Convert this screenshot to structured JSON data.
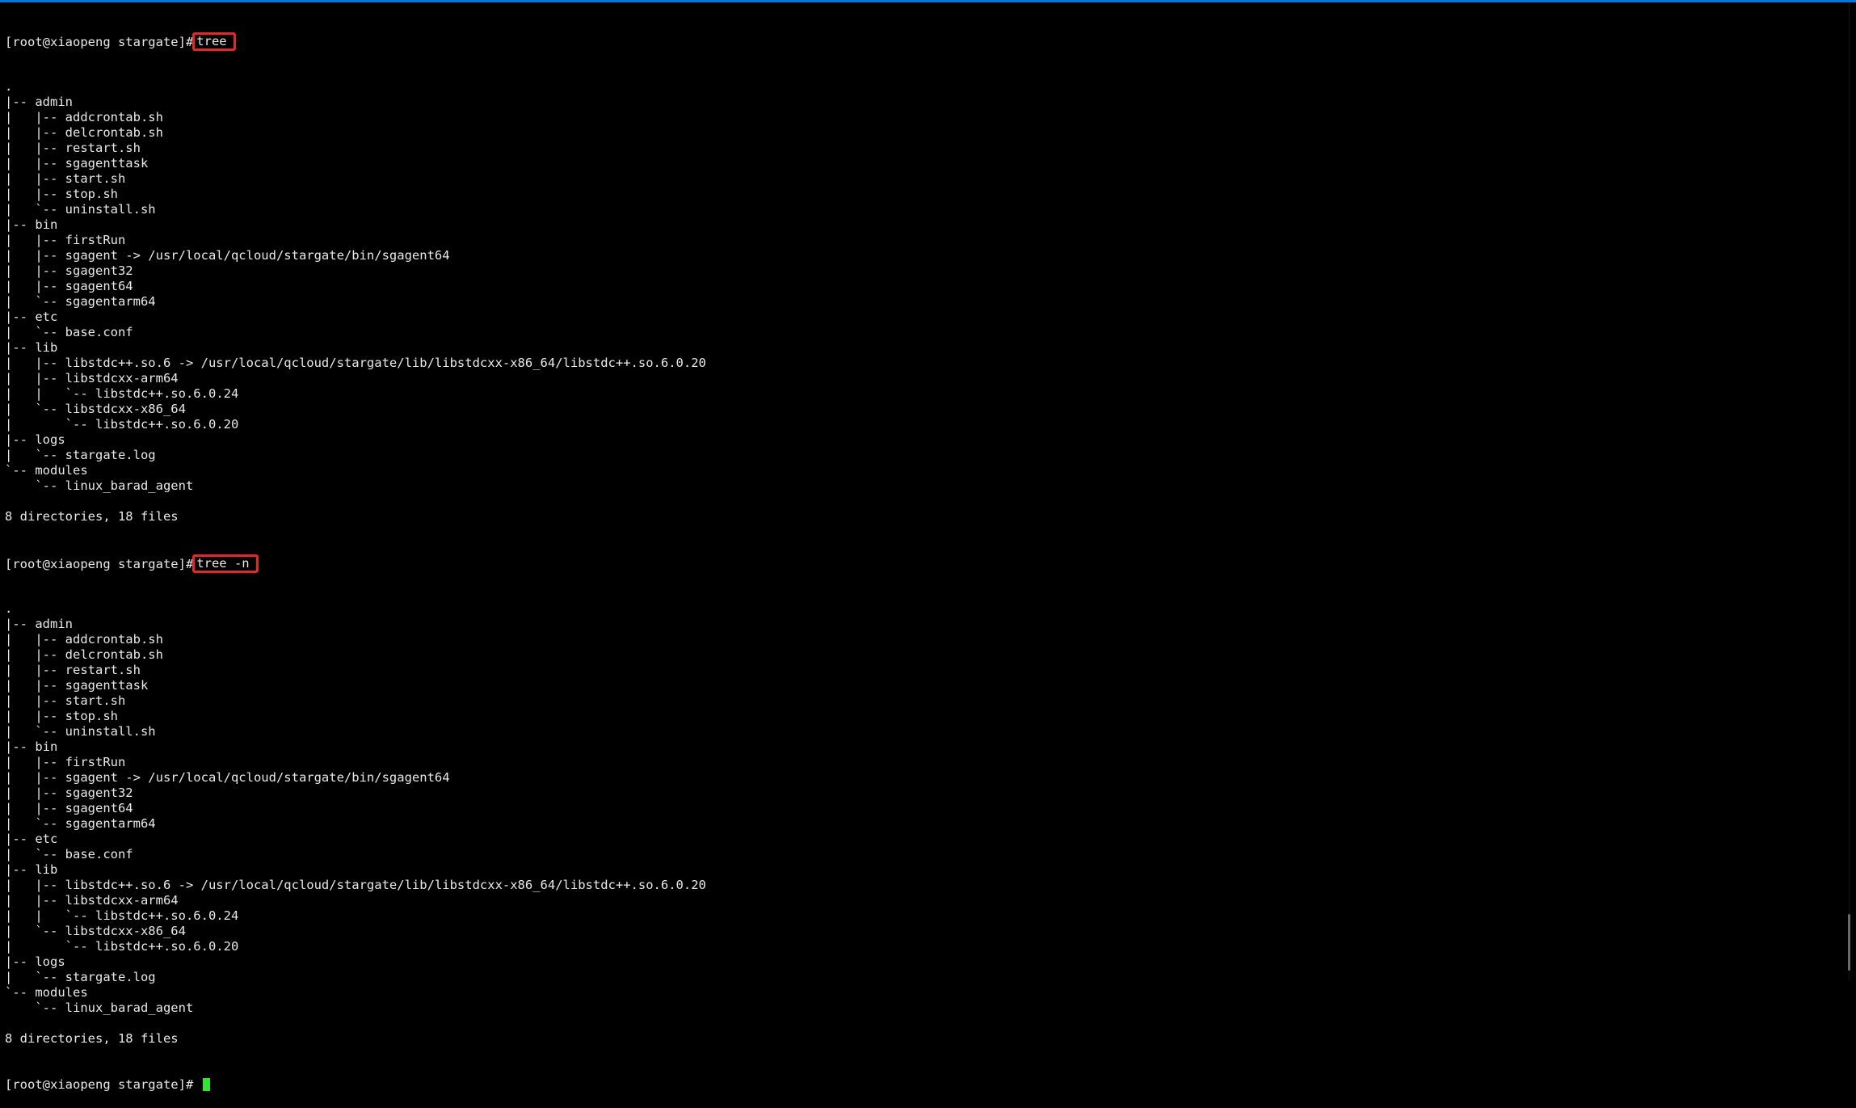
{
  "terminal": {
    "prompt": "[root@xiaopeng stargate]#",
    "command1": "tree",
    "output1": [
      ".",
      "|-- admin",
      "|   |-- addcrontab.sh",
      "|   |-- delcrontab.sh",
      "|   |-- restart.sh",
      "|   |-- sgagenttask",
      "|   |-- start.sh",
      "|   |-- stop.sh",
      "|   `-- uninstall.sh",
      "|-- bin",
      "|   |-- firstRun",
      "|   |-- sgagent -> /usr/local/qcloud/stargate/bin/sgagent64",
      "|   |-- sgagent32",
      "|   |-- sgagent64",
      "|   `-- sgagentarm64",
      "|-- etc",
      "|   `-- base.conf",
      "|-- lib",
      "|   |-- libstdc++.so.6 -> /usr/local/qcloud/stargate/lib/libstdcxx-x86_64/libstdc++.so.6.0.20",
      "|   |-- libstdcxx-arm64",
      "|   |   `-- libstdc++.so.6.0.24",
      "|   `-- libstdcxx-x86_64",
      "|       `-- libstdc++.so.6.0.20",
      "|-- logs",
      "|   `-- stargate.log",
      "`-- modules",
      "    `-- linux_barad_agent",
      "",
      "8 directories, 18 files"
    ],
    "command2": "tree -n",
    "output2": [
      ".",
      "|-- admin",
      "|   |-- addcrontab.sh",
      "|   |-- delcrontab.sh",
      "|   |-- restart.sh",
      "|   |-- sgagenttask",
      "|   |-- start.sh",
      "|   |-- stop.sh",
      "|   `-- uninstall.sh",
      "|-- bin",
      "|   |-- firstRun",
      "|   |-- sgagent -> /usr/local/qcloud/stargate/bin/sgagent64",
      "|   |-- sgagent32",
      "|   |-- sgagent64",
      "|   `-- sgagentarm64",
      "|-- etc",
      "|   `-- base.conf",
      "|-- lib",
      "|   |-- libstdc++.so.6 -> /usr/local/qcloud/stargate/lib/libstdcxx-x86_64/libstdc++.so.6.0.20",
      "|   |-- libstdcxx-arm64",
      "|   |   `-- libstdc++.so.6.0.24",
      "|   `-- libstdcxx-x86_64",
      "|       `-- libstdc++.so.6.0.20",
      "|-- logs",
      "|   `-- stargate.log",
      "`-- modules",
      "    `-- linux_barad_agent",
      "",
      "8 directories, 18 files"
    ]
  },
  "colors": {
    "background": "#000000",
    "text": "#e8e8e8",
    "highlight_box": "#e8262a",
    "cursor": "#2fe52f",
    "top_accent": "#0a74d8"
  },
  "icons": {
    "cursor": "block-cursor-icon"
  }
}
